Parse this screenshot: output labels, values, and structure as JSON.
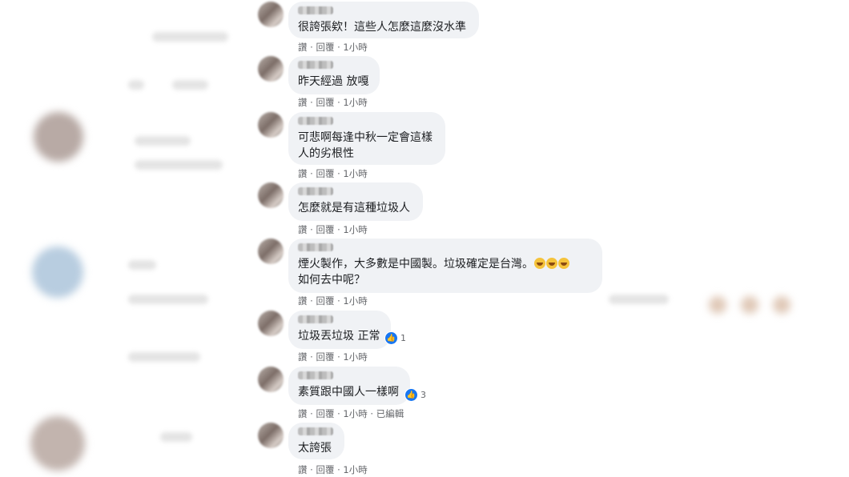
{
  "comments": [
    {
      "text": "很誇張欸！這些人怎麼這麼沒水準",
      "meta": "讚 · 回覆 · 1小時"
    },
    {
      "text": "昨天經過 放嘎",
      "meta": "讚 · 回覆 · 1小時"
    },
    {
      "text": "可悲啊每逢中秋一定會這樣\n人的劣根性",
      "meta": "讚 · 回覆 · 1小時"
    },
    {
      "text": "怎麼就是有這種垃圾人",
      "meta": "讚 · 回覆 · 1小時"
    },
    {
      "text": "煙火製作，大多數是中國製。垃圾確定是台灣。",
      "text2": "如何去中呢？",
      "meta": "讚 · 回覆 · 1小時",
      "emoji": "rolling-on-floor-laughing-icon"
    },
    {
      "text": "垃圾丟垃圾 正常",
      "meta": "讚 · 回覆 · 1小時",
      "reactions": "1"
    },
    {
      "text": "素質跟中國人一樣啊",
      "meta": "讚 · 回覆 · 1小時 · 已編輯",
      "reactions": "3"
    },
    {
      "text": "太誇張",
      "meta": "讚 · 回覆 · 1小時"
    }
  ],
  "colors": {
    "bubble": "#f0f2f5",
    "meta": "#65676b",
    "text": "#1c1e21",
    "like": "#1877f2"
  }
}
